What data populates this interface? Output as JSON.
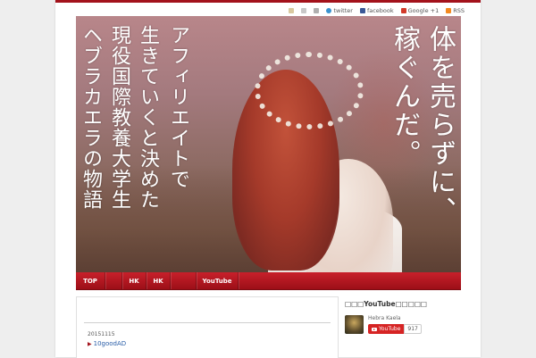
{
  "social_bar": {
    "twitter_label": "twitter",
    "facebook_label": "facebook",
    "googleplus_label": "Google +1",
    "rss_label": "RSS"
  },
  "hero": {
    "vertical_lines": [
      "体を売らずに、",
      "稼ぐんだ。",
      "アフィリエイトで",
      "生きていくと決めた",
      "現役国際教養大学生",
      "ヘブラカエラの物語"
    ]
  },
  "nav": {
    "items": [
      {
        "label": "TOP"
      },
      {
        "label": ""
      },
      {
        "label": "HK"
      },
      {
        "label": "HK"
      },
      {
        "label": ""
      },
      {
        "label": "YouTube"
      }
    ]
  },
  "post": {
    "date": "20151115",
    "title": "10goodAD"
  },
  "sidebar": {
    "title": "□□□YouTube□□□□□",
    "channel_name": "Hebra Kaela",
    "subscribe_label": "YouTube",
    "subscriber_count": "917"
  },
  "colors": {
    "brand_red": "#a3121b",
    "nav_red": "#c8202b",
    "link_blue": "#2a5ea8",
    "youtube_red": "#d62424"
  }
}
